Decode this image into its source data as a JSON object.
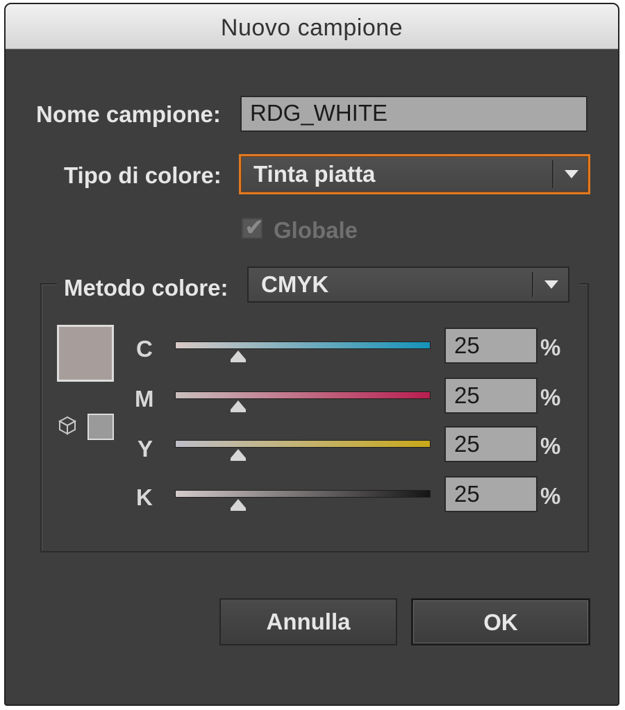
{
  "dialog": {
    "title": "Nuovo campione"
  },
  "swatch_name": {
    "label": "Nome campione:",
    "value": "RDG_WHITE"
  },
  "color_type": {
    "label": "Tipo di colore:",
    "selected": "Tinta piatta"
  },
  "global": {
    "label": "Globale",
    "checked": true,
    "disabled": true
  },
  "color_mode": {
    "label": "Metodo colore:",
    "selected": "CMYK"
  },
  "preview": {
    "swatch_color": "#a79e9c",
    "gamut_icon": "cube-icon"
  },
  "channels": [
    {
      "letter": "C",
      "value": "25",
      "unit": "%",
      "end_color": "#1592b8"
    },
    {
      "letter": "M",
      "value": "25",
      "unit": "%",
      "end_color": "#b81e50"
    },
    {
      "letter": "Y",
      "value": "25",
      "unit": "%",
      "end_color": "#c9a81a"
    },
    {
      "letter": "K",
      "value": "25",
      "unit": "%",
      "end_color": "#151515"
    }
  ],
  "buttons": {
    "cancel": "Annulla",
    "ok": "OK"
  }
}
